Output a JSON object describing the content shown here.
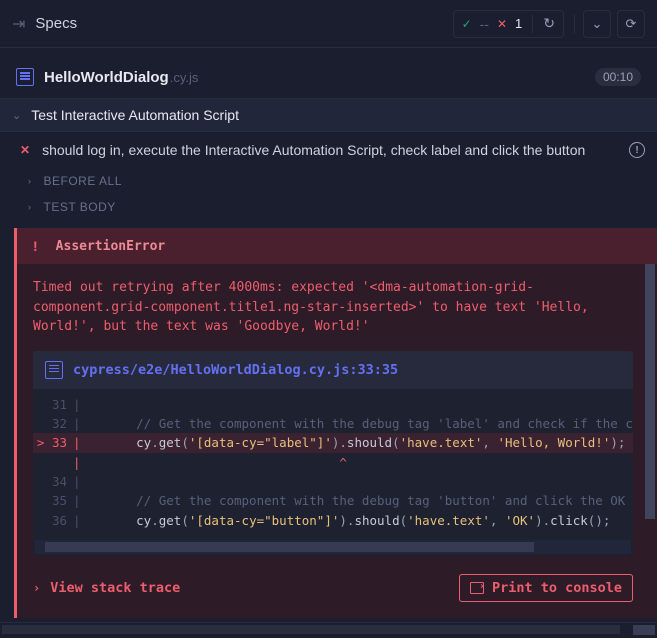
{
  "topbar": {
    "title": "Specs",
    "pass_marker": "✓",
    "pass_count": "--",
    "fail_marker": "✕",
    "fail_count": "1"
  },
  "file": {
    "name": "HelloWorldDialog",
    "ext": ".cy.js",
    "timer": "00:10"
  },
  "describe": {
    "title": "Test Interactive Automation Script"
  },
  "test": {
    "title": "should log in, execute the Interactive Automation Script, check label and click the button"
  },
  "sections": {
    "before": "BEFORE ALL",
    "body": "TEST BODY"
  },
  "error": {
    "type": "AssertionError",
    "message": "Timed out retrying after 4000ms: expected '<dma-automation-grid-component.grid-component.title1.ng-star-inserted>' to have text 'Hello, World!', but the text was 'Goodbye, World!'",
    "file_path": "cypress/e2e/HelloWorldDialog.cy.js:33:35"
  },
  "code": {
    "lines": [
      {
        "n": "31",
        "hl": false,
        "kind": "blank"
      },
      {
        "n": "32",
        "hl": false,
        "kind": "comment",
        "text": "// Get the component with the debug tag 'label' and check if the c"
      },
      {
        "n": "33",
        "hl": true,
        "kind": "code1",
        "selector": "'[data-cy=\"label\"]'",
        "assert": "'have.text'",
        "value": "'Hello, World!'"
      },
      {
        "n": "",
        "hl": false,
        "kind": "caret"
      },
      {
        "n": "34",
        "hl": false,
        "kind": "blank"
      },
      {
        "n": "35",
        "hl": false,
        "kind": "comment",
        "text": "// Get the component with the debug tag 'button' and click the OK "
      },
      {
        "n": "36",
        "hl": false,
        "kind": "code2",
        "selector": "'[data-cy=\"button\"]'",
        "assert": "'have.text'",
        "value": "'OK'"
      }
    ]
  },
  "actions": {
    "stack": "View stack trace",
    "print": "Print to console"
  }
}
